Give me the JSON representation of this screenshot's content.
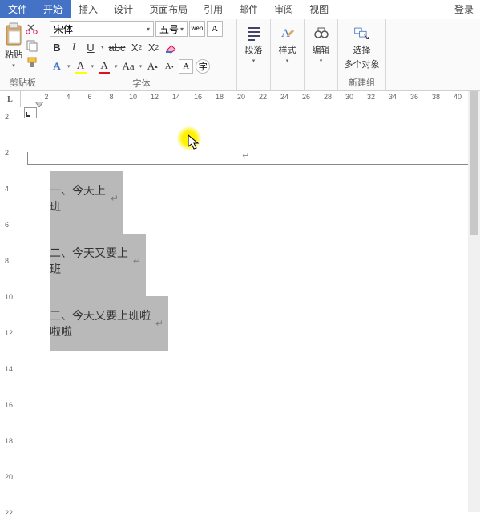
{
  "tabs": {
    "file": "文件",
    "start": "开始",
    "insert": "插入",
    "design": "设计",
    "layout": "页面布局",
    "references": "引用",
    "mail": "邮件",
    "review": "审阅",
    "view": "视图",
    "login": "登录"
  },
  "clipboard": {
    "paste": "粘贴",
    "label": "剪贴板"
  },
  "font": {
    "family": "宋体",
    "size": "五号",
    "wen": "wén",
    "label": "字体"
  },
  "para": {
    "label": "段落"
  },
  "styles": {
    "label": "样式"
  },
  "edit": {
    "label": "编辑"
  },
  "select": {
    "label": "选择",
    "sub": "多个对象",
    "group": "新建组"
  },
  "ruler": {
    "h": [
      "2",
      "4",
      "6",
      "8",
      "10",
      "12",
      "14",
      "16",
      "18",
      "20",
      "22",
      "24",
      "26",
      "28",
      "30",
      "32",
      "34",
      "36",
      "38",
      "40"
    ],
    "v": [
      "2",
      "2",
      "4",
      "6",
      "8",
      "10",
      "12",
      "14",
      "16",
      "18",
      "20",
      "22"
    ]
  },
  "document": {
    "header_mark": "↵",
    "lines": [
      "一、今天上班",
      "二、今天又要上班",
      "三、今天又要上班啦啦啦"
    ],
    "pm": "↵"
  }
}
